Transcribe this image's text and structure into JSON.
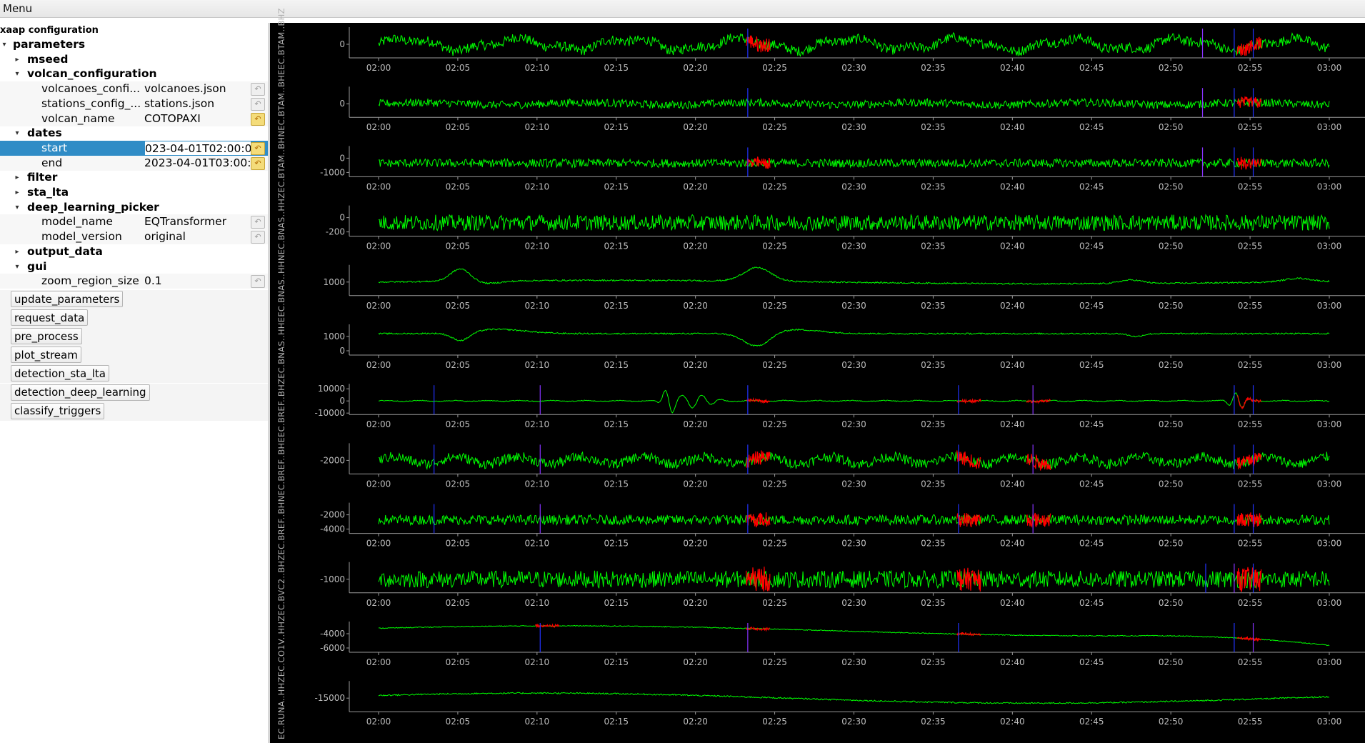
{
  "menubar": {
    "menu_label": "Menu"
  },
  "config": {
    "title": "xaap configuration",
    "root": "parameters",
    "rows": [
      {
        "kind": "node",
        "depth": 1,
        "label": "mseed",
        "expanded": false
      },
      {
        "kind": "node",
        "depth": 1,
        "label": "volcan_configuration",
        "expanded": true
      },
      {
        "kind": "param",
        "key": "volcanoes_confi...",
        "value": "volcanoes.json",
        "reset_active": false
      },
      {
        "kind": "param",
        "key": "stations_config_...",
        "value": "stations.json",
        "reset_active": false
      },
      {
        "kind": "param",
        "key": "volcan_name",
        "value": "COTOPAXI",
        "reset_active": true
      },
      {
        "kind": "node",
        "depth": 1,
        "label": "dates",
        "expanded": true
      },
      {
        "kind": "param",
        "key": "start",
        "value": "023-04-01T02:00:0(",
        "reset_active": true,
        "selected": true
      },
      {
        "kind": "param",
        "key": "end",
        "value": "2023-04-01T03:00:(",
        "reset_active": true
      },
      {
        "kind": "node",
        "depth": 1,
        "label": "filter",
        "expanded": false
      },
      {
        "kind": "node",
        "depth": 1,
        "label": "sta_lta",
        "expanded": false
      },
      {
        "kind": "node",
        "depth": 1,
        "label": "deep_learning_picker",
        "expanded": true
      },
      {
        "kind": "param",
        "key": "model_name",
        "value": "EQTransformer",
        "reset_active": false
      },
      {
        "kind": "param",
        "key": "model_version",
        "value": "original",
        "reset_active": false
      },
      {
        "kind": "node",
        "depth": 1,
        "label": "output_data",
        "expanded": false
      },
      {
        "kind": "node",
        "depth": 1,
        "label": "gui",
        "expanded": true
      },
      {
        "kind": "param",
        "key": "zoom_region_size",
        "value": "0.1",
        "reset_active": false
      }
    ]
  },
  "actions": [
    "update_parameters",
    "request_data",
    "pre_process",
    "plot_stream",
    "detection_sta_lta",
    "detection_deep_learning",
    "classify_triggers"
  ],
  "colors": {
    "trace": "#00ff00",
    "event": "#ff0000",
    "pick_p": "#2233ff",
    "pick_s": "#8833ff"
  },
  "station_label": "EC.RUNA..HHZEC.CO1V..HHZEC.BVC2..BHZEC.BREF..BHNEC.BREF..BHEEC.BREF..BHZEC.BNAS..HHEEC.BNAS..HHNEC.BNAS..HHZEC.BTAM..BHNEC.BTAM..BHEEC.BTAM..BHZ",
  "time_ticks": [
    "02:00",
    "02:05",
    "02:10",
    "02:15",
    "02:20",
    "02:25",
    "02:30",
    "02:35",
    "02:40",
    "02:45",
    "02:50",
    "02:55",
    "03:00"
  ],
  "panels": [
    {
      "yticks": [
        "0"
      ],
      "events": [
        23.5,
        54.5
      ],
      "picks": [
        23.3,
        52,
        54,
        55.2
      ]
    },
    {
      "yticks": [
        "0"
      ],
      "events": [
        54.5
      ],
      "picks": [
        23.3,
        52,
        54,
        55.2
      ]
    },
    {
      "yticks": [
        "0",
        "-1000"
      ],
      "events": [
        23.5,
        54.5
      ],
      "picks": [
        23.3,
        52,
        54,
        55.2
      ]
    },
    {
      "yticks": [
        "0",
        "-200"
      ],
      "events": [],
      "picks": []
    },
    {
      "yticks": [
        "1000"
      ],
      "events": [],
      "picks": []
    },
    {
      "yticks": [
        "1000",
        "0"
      ],
      "events": [],
      "picks": []
    },
    {
      "yticks": [
        "10000",
        "0",
        "-10000"
      ],
      "events": [
        23.5,
        36.8,
        41.2,
        54.5
      ],
      "picks": [
        3.5,
        10.2,
        23.3,
        36.6,
        41.3,
        54,
        55.2
      ]
    },
    {
      "yticks": [
        "-2000"
      ],
      "events": [
        23.5,
        36.8,
        41.2,
        54.5
      ],
      "picks": [
        3.5,
        10.2,
        23.3,
        36.6,
        41.3,
        54,
        55.2
      ]
    },
    {
      "yticks": [
        "-2000",
        "-4000"
      ],
      "events": [
        23.5,
        36.8,
        41.2,
        54.5
      ],
      "picks": [
        3.5,
        10.2,
        23.3,
        36.6,
        41.3,
        54,
        55.2
      ]
    },
    {
      "yticks": [
        "-1000"
      ],
      "events": [
        23.5,
        36.8,
        54.5
      ],
      "picks": [
        52.2,
        54,
        55.2
      ]
    },
    {
      "yticks": [
        "-4000",
        "-6000"
      ],
      "events": [
        10.2,
        23.5,
        36.8,
        54.5
      ],
      "picks": [
        10.2,
        23.3,
        36.6,
        54,
        55.2
      ]
    },
    {
      "yticks": [
        "-15000"
      ],
      "events": [],
      "picks": []
    }
  ]
}
